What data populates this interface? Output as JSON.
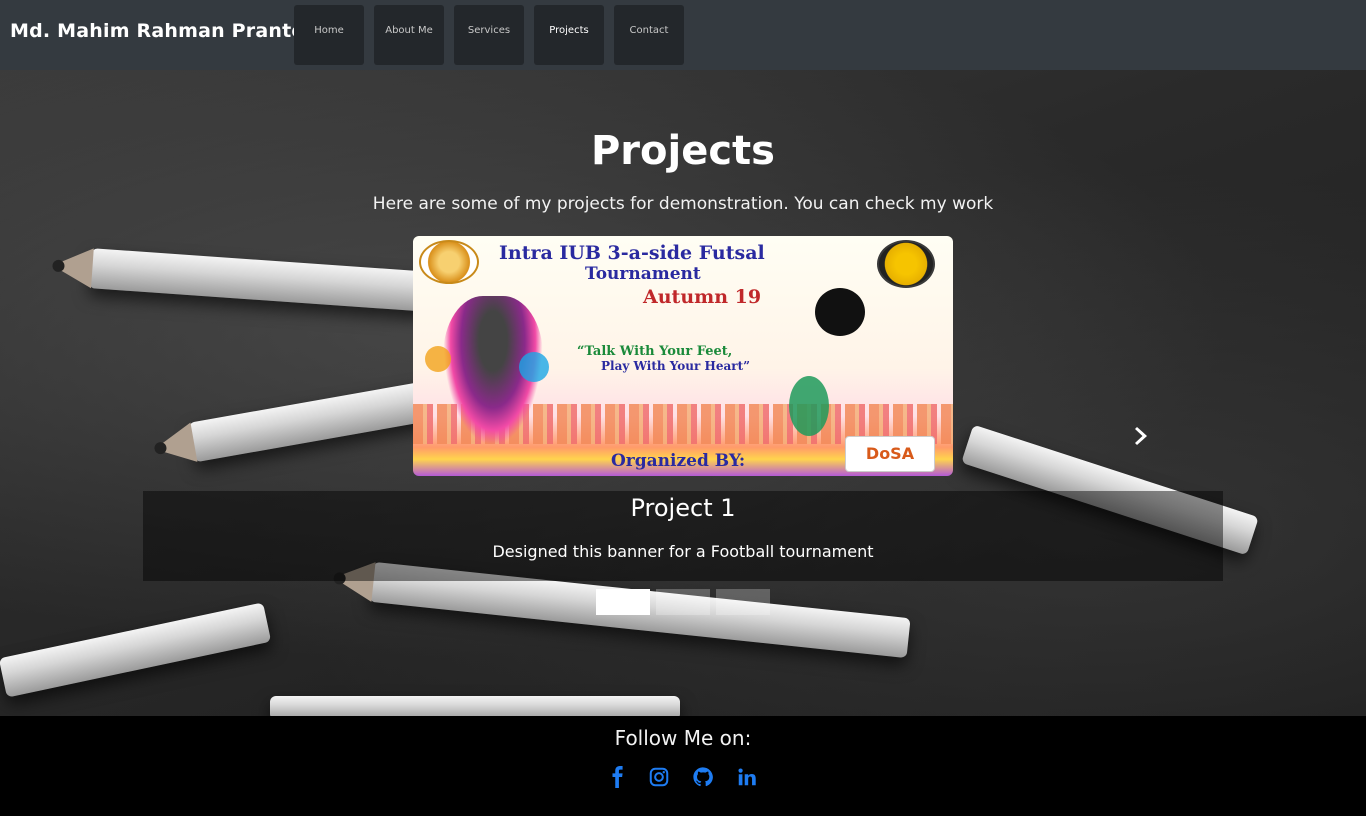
{
  "navbar": {
    "brand": "Md. Mahim Rahman Pranto",
    "items": [
      {
        "label": "Home"
      },
      {
        "label": "About Me"
      },
      {
        "label": "Services"
      },
      {
        "label": "Projects",
        "active": true
      },
      {
        "label": "Contact"
      }
    ]
  },
  "main": {
    "title": "Projects",
    "subtitle": "Here are some of my projects for demonstration. You can check my work",
    "carousel": {
      "banner": {
        "line1": "Intra IUB 3-a-side Futsal",
        "line2": "Tournament",
        "line3": "Autumn 19",
        "quote1": "“Talk With Your Feet,",
        "quote2": "Play With Your Heart”",
        "organized": "Organized BY:",
        "logo_text": "DoSA"
      },
      "caption_title": "Project 1",
      "caption_text": "Designed this banner for a Football tournament",
      "next_icon": "chevron-right-icon",
      "indicators": 3,
      "active_index": 0
    }
  },
  "footer": {
    "follow_label": "Follow Me on:",
    "social": [
      {
        "icon": "facebook-icon"
      },
      {
        "icon": "instagram-icon"
      },
      {
        "icon": "github-icon"
      },
      {
        "icon": "linkedin-icon"
      }
    ],
    "icon_color": "#1e7cf2"
  }
}
